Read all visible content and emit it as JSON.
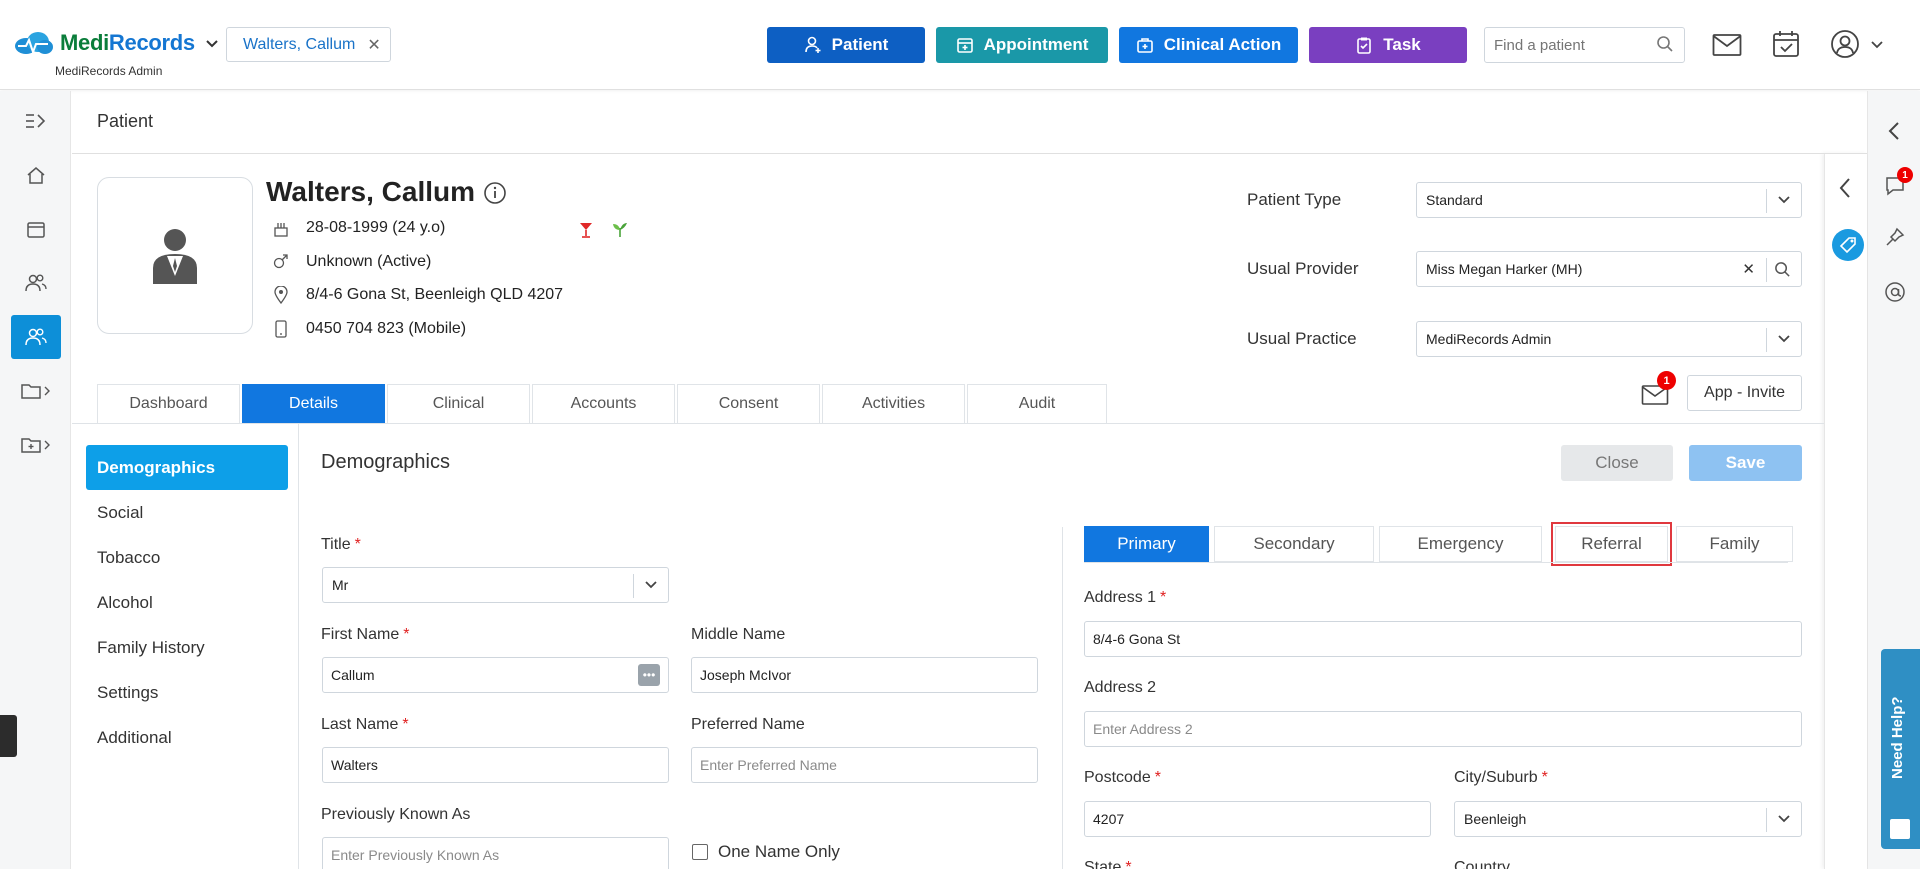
{
  "header": {
    "logo_medi": "Medi",
    "logo_records": "Records",
    "logo_sub": "MediRecords Admin",
    "open_patient": "Walters, Callum",
    "buttons": {
      "patient": "Patient",
      "appointment": "Appointment",
      "clinical_action": "Clinical Action",
      "task": "Task"
    },
    "search_placeholder": "Find a patient"
  },
  "page": {
    "title": "Patient"
  },
  "patient": {
    "name": "Walters, Callum",
    "dob": "28-08-1999 (24 y.o)",
    "gender": "Unknown (Active)",
    "address": "8/4-6 Gona St, Beenleigh QLD 4207",
    "phone": "0450 704 823 (Mobile)",
    "type_label": "Patient Type",
    "type_value": "Standard",
    "provider_label": "Usual Provider",
    "provider_value": "Miss Megan Harker (MH)",
    "practice_label": "Usual Practice",
    "practice_value": "MediRecords Admin"
  },
  "tabs": [
    "Dashboard",
    "Details",
    "Clinical",
    "Accounts",
    "Consent",
    "Activities",
    "Audit"
  ],
  "active_tab": "Details",
  "mail_badge": "1",
  "chat_badge": "1",
  "app_invite": "App - Invite",
  "subnav": [
    "Demographics",
    "Social",
    "Tobacco",
    "Alcohol",
    "Family History",
    "Settings",
    "Additional"
  ],
  "section": {
    "title": "Demographics",
    "close": "Close",
    "save": "Save"
  },
  "form": {
    "title_label": "Title",
    "title_value": "Mr",
    "first_name_label": "First Name",
    "first_name_value": "Callum",
    "middle_name_label": "Middle Name",
    "middle_name_value": "Joseph McIvor",
    "last_name_label": "Last Name",
    "last_name_value": "Walters",
    "preferred_name_label": "Preferred Name",
    "preferred_name_placeholder": "Enter Preferred Name",
    "prev_known_label": "Previously Known As",
    "prev_known_placeholder": "Enter Previously Known As",
    "one_name_only": "One Name Only"
  },
  "contact_tabs": [
    "Primary",
    "Secondary",
    "Emergency",
    "Referral",
    "Family"
  ],
  "address": {
    "address1_label": "Address 1",
    "address1_value": "8/4-6 Gona St",
    "address2_label": "Address 2",
    "address2_placeholder": "Enter Address 2",
    "postcode_label": "Postcode",
    "postcode_value": "4207",
    "city_label": "City/Suburb",
    "city_value": "Beenleigh",
    "state_label": "State",
    "country_label": "Country"
  },
  "need_help": "Need Help?",
  "colors": {
    "brand_blue": "#1177e0",
    "appointment_teal": "#1a98a8",
    "task_purple": "#7a3fc0",
    "active_subnav": "#0d9fe8",
    "highlight_red": "#e0383e"
  }
}
